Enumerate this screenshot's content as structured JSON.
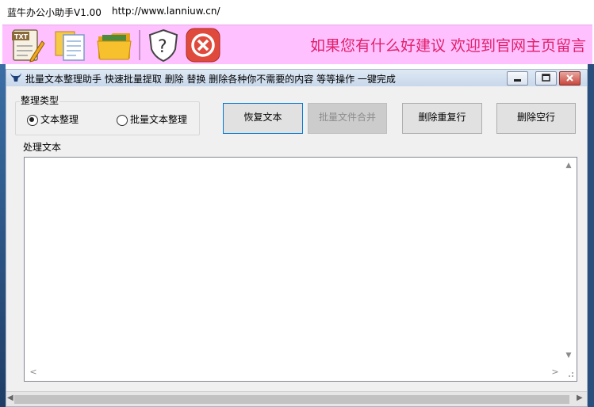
{
  "outer_window": {
    "title": "蓝牛办公小助手V1.00",
    "url": "http://www.lanniuw.cn/"
  },
  "toolbar": {
    "tools": [
      {
        "icon": "txt-notepad-icon"
      },
      {
        "icon": "documents-icon"
      },
      {
        "icon": "folder-icon"
      },
      {
        "icon": "help-shield-icon"
      },
      {
        "icon": "close-circle-icon"
      }
    ],
    "promo_text": "如果您有什么好建议 欢迎到官网主页留言"
  },
  "inner_window": {
    "title": "批量文本整理助手   快速批量提取 删除 替换 删除各种你不需要的内容 等等操作 一键完成",
    "window_buttons": {
      "minimize": "▭",
      "maximize": "▢",
      "close": "✕"
    },
    "group_label": "整理类型",
    "radios": [
      {
        "label": "文本整理",
        "checked": true
      },
      {
        "label": "批量文本整理",
        "checked": false
      }
    ],
    "buttons": {
      "restore": "恢复文本",
      "merge": "批量文件合并",
      "dedupe": "删除重复行",
      "blank": "删除空行"
    },
    "text_label": "处理文本",
    "text_value": "",
    "scroll": {
      "up": "▲",
      "down": "▼",
      "left": "<",
      "right": ">"
    }
  },
  "colors": {
    "toolbar_bg": "#ffc0ff",
    "promo": "#e0206a",
    "focus_border": "#0078d7"
  }
}
